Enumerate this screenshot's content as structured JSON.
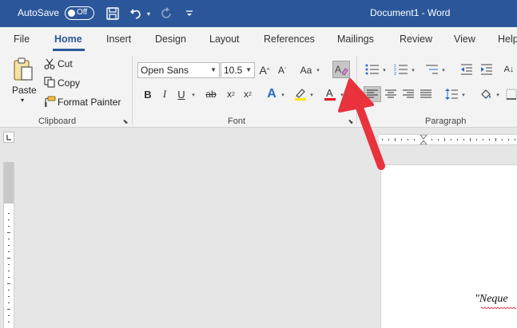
{
  "titlebar": {
    "autosave_label": "AutoSave",
    "autosave_state": "Off",
    "document_title": "Document1  -  Word"
  },
  "tabs": [
    {
      "label": "File"
    },
    {
      "label": "Home",
      "active": true
    },
    {
      "label": "Insert"
    },
    {
      "label": "Design"
    },
    {
      "label": "Layout"
    },
    {
      "label": "References"
    },
    {
      "label": "Mailings"
    },
    {
      "label": "Review"
    },
    {
      "label": "View"
    },
    {
      "label": "Help"
    }
  ],
  "clipboard": {
    "paste_label": "Paste",
    "cut_label": "Cut",
    "copy_label": "Copy",
    "format_painter_label": "Format Painter",
    "group_label": "Clipboard"
  },
  "font": {
    "font_name": "Open Sans",
    "font_size": "10.5",
    "change_case_label": "Aa",
    "group_label": "Font"
  },
  "paragraph": {
    "group_label": "Paragraph"
  },
  "document": {
    "visible_text": "\"Neque"
  },
  "colors": {
    "title_bar": "#2b579a",
    "accent": "#2b579a",
    "annotation_arrow": "#e8323c",
    "font_color_bar": "#e81123"
  }
}
